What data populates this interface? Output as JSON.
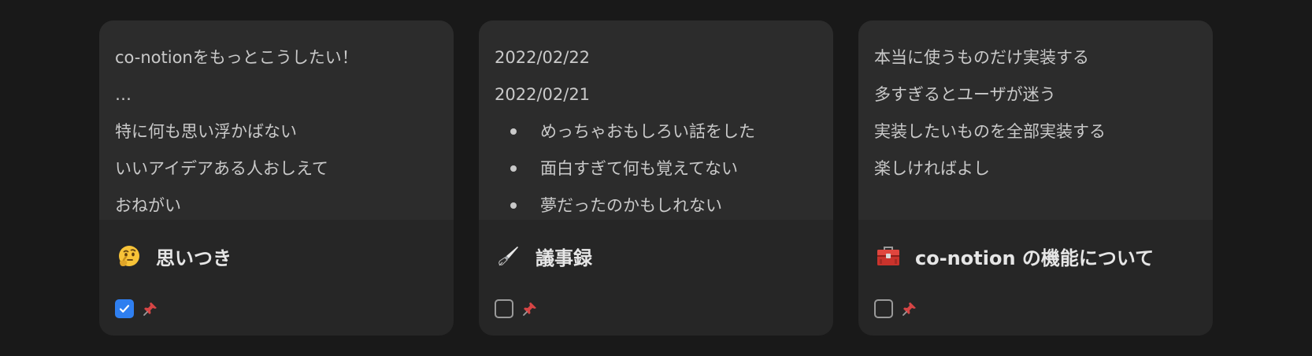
{
  "cards": [
    {
      "preview": {
        "lines": [
          "co-notionをもっとこうしたい！",
          "…",
          "特に何も思い浮かばない",
          "いいアイデアある人おしえて",
          "おねがい"
        ]
      },
      "icon": "thinking-face-icon",
      "title": "思いつき",
      "checked": true
    },
    {
      "preview": {
        "lines": [
          "2022/02/22",
          "2022/02/21"
        ],
        "bullets": [
          "めっちゃおもしろい話をした",
          "面白すぎて何も覚えてない",
          "夢だったのかもしれない"
        ]
      },
      "icon": "fountain-pen-icon",
      "title": "議事録",
      "checked": false
    },
    {
      "preview": {
        "lines": [
          "本当に使うものだけ実装する",
          "多すぎるとユーザが迷う",
          "実装したいものを全部実装する",
          "楽しければよし"
        ]
      },
      "icon": "toolbox-icon",
      "title": "co-notion の機能について",
      "checked": false
    }
  ],
  "colors": {
    "background": "#191919",
    "card": "#262626",
    "preview": "#2c2c2c",
    "accent": "#2f7ff0",
    "pin": "#d64545"
  }
}
